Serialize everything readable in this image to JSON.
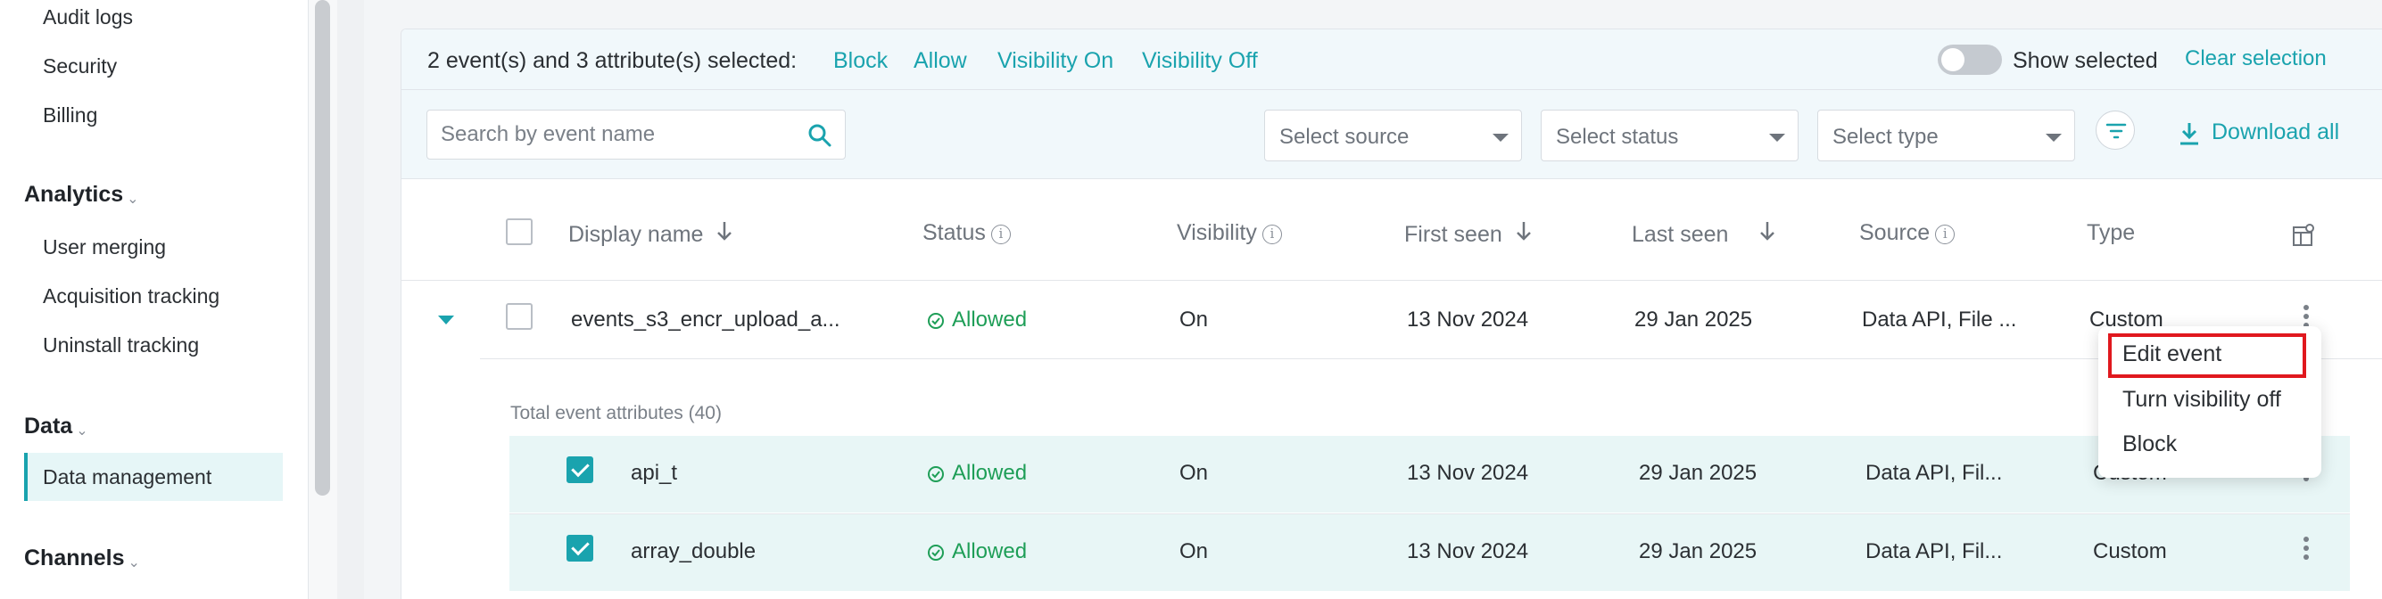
{
  "sidebar": {
    "items_top": [
      "Audit logs",
      "Security",
      "Billing"
    ],
    "analytics": {
      "label": "Analytics",
      "items": [
        "User merging",
        "Acquisition tracking",
        "Uninstall tracking"
      ]
    },
    "data": {
      "label": "Data",
      "active_item": "Data management"
    },
    "channels": {
      "label": "Channels"
    },
    "chevron": "chevron-down-icon"
  },
  "selection_bar": {
    "summary": "2 event(s) and 3 attribute(s) selected:",
    "actions": [
      "Block",
      "Allow",
      "Visibility On",
      "Visibility Off"
    ],
    "show_selected_label": "Show selected",
    "show_selected_on": false,
    "clear_label": "Clear selection"
  },
  "filters": {
    "search_placeholder": "Search by event name",
    "selects": [
      "Select source",
      "Select status",
      "Select type"
    ],
    "download_label": "Download all"
  },
  "table": {
    "columns": {
      "display_name": "Display name",
      "status": "Status",
      "visibility": "Visibility",
      "first_seen": "First seen",
      "last_seen": "Last seen",
      "source": "Source",
      "type": "Type"
    },
    "event_row": {
      "name": "events_s3_encr_upload_a...",
      "status": "Allowed",
      "visibility": "On",
      "first_seen": "13 Nov 2024",
      "last_seen": "29 Jan 2025",
      "source": "Data API, File ...",
      "type": "Custom",
      "expanded": true,
      "selected": false
    },
    "attributes_label": "Total event attributes (40)",
    "attribute_rows": [
      {
        "name": "api_t",
        "status": "Allowed",
        "visibility": "On",
        "first_seen": "13 Nov 2024",
        "last_seen": "29 Jan 2025",
        "source": "Data API, Fil...",
        "type": "Custom",
        "selected": true
      },
      {
        "name": "array_double",
        "status": "Allowed",
        "visibility": "On",
        "first_seen": "13 Nov 2024",
        "last_seen": "29 Jan 2025",
        "source": "Data API, Fil...",
        "type": "Custom",
        "selected": true
      }
    ]
  },
  "context_menu": {
    "items": [
      "Edit event",
      "Turn visibility off",
      "Block"
    ],
    "highlighted": "Edit event"
  },
  "colors": {
    "accent": "#1aa3ae",
    "allowed_green": "#1e9e57",
    "highlight_red": "#e0181e",
    "row_selected_bg": "#e8f6f6"
  }
}
